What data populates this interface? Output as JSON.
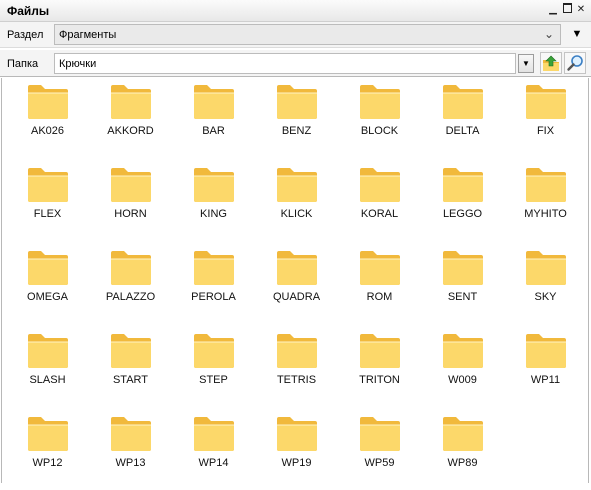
{
  "window": {
    "title": "Файлы",
    "controls": [
      "minimize",
      "maximize",
      "close"
    ]
  },
  "section": {
    "label": "Раздел",
    "value": "Фрагменты"
  },
  "folder_field": {
    "label": "Папка",
    "value": "Крючки"
  },
  "toolbar_icons": [
    "folder-up-icon",
    "search-icon"
  ],
  "colors": {
    "folder_front": "#fcd86a",
    "folder_back": "#f1b93c",
    "panel_bg": "#f4f4f4"
  },
  "folders": [
    "AK026",
    "AKKORD",
    "BAR",
    "BENZ",
    "BLOCK",
    "DELTA",
    "FIX",
    "FLEX",
    "HORN",
    "KING",
    "KLICK",
    "KORAL",
    "LEGGO",
    "MYHITO",
    "OMEGA",
    "PALAZZO",
    "PEROLA",
    "QUADRA",
    "ROM",
    "SENT",
    "SKY",
    "SLASH",
    "START",
    "STEP",
    "TETRIS",
    "TRITON",
    "W009",
    "WP11",
    "WP12",
    "WP13",
    "WP14",
    "WP19",
    "WP59",
    "WP89"
  ]
}
